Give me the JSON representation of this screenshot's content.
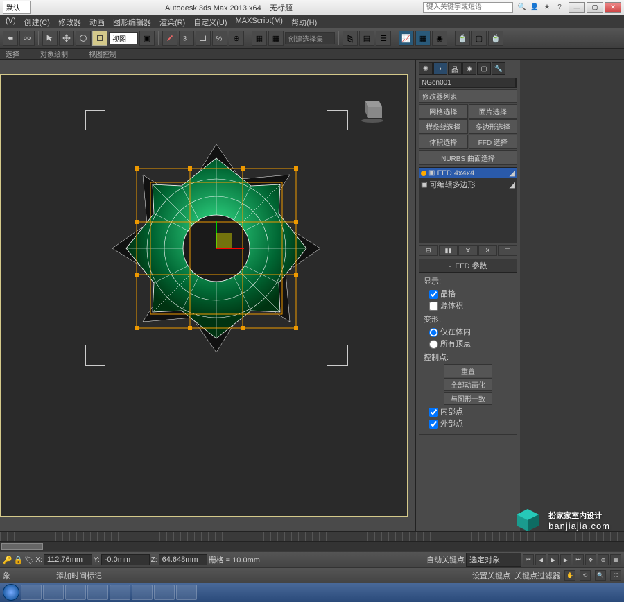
{
  "title": {
    "dropdown": "默认",
    "app": "Autodesk 3ds Max  2013 x64",
    "doc": "无标题",
    "search_ph": "键入关键字或短语"
  },
  "menus": [
    "(V)",
    "创建(C)",
    "修改器",
    "动画",
    "图形编辑器",
    "渲染(R)",
    "自定义(U)",
    "MAXScript(M)",
    "帮助(H)"
  ],
  "toolbar": {
    "view": "视图",
    "selset": "创建选择集"
  },
  "subbar": [
    "选择",
    "对象绘制",
    "视图控制"
  ],
  "panel": {
    "name": "NGon001",
    "modlist": "修改器列表",
    "btns": [
      "网格选择",
      "面片选择",
      "样条线选择",
      "多边形选择",
      "体积选择",
      "FFD 选择"
    ],
    "nurbs": "NURBS 曲面选择",
    "stack": [
      {
        "label": "FFD 4x4x4",
        "sel": true
      },
      {
        "label": "可编辑多边形",
        "sel": false
      }
    ],
    "roll_title": "FFD 参数",
    "display": "显示:",
    "lattice": "晶格",
    "source": "源体积",
    "deform": "变形:",
    "inside": "仅在体内",
    "all": "所有顶点",
    "ctrl": "控制点:",
    "reset": "重置",
    "animall": "全部动画化",
    "conform": "与图形一致",
    "inner": "内部点",
    "outer": "外部点"
  },
  "coords": {
    "x": "112.76mm",
    "y": "-0.0mm",
    "z": "64.648mm",
    "grid": "栅格 = 10.0mm",
    "add": "添加时间标记"
  },
  "status2": {
    "auto": "自动关键点",
    "sel": "选定对象",
    "set": "设置关键点",
    "filt": "关键点过滤器"
  },
  "watermark": {
    "main": "扮家家室内设计",
    "sub": "banjiajia.com"
  }
}
